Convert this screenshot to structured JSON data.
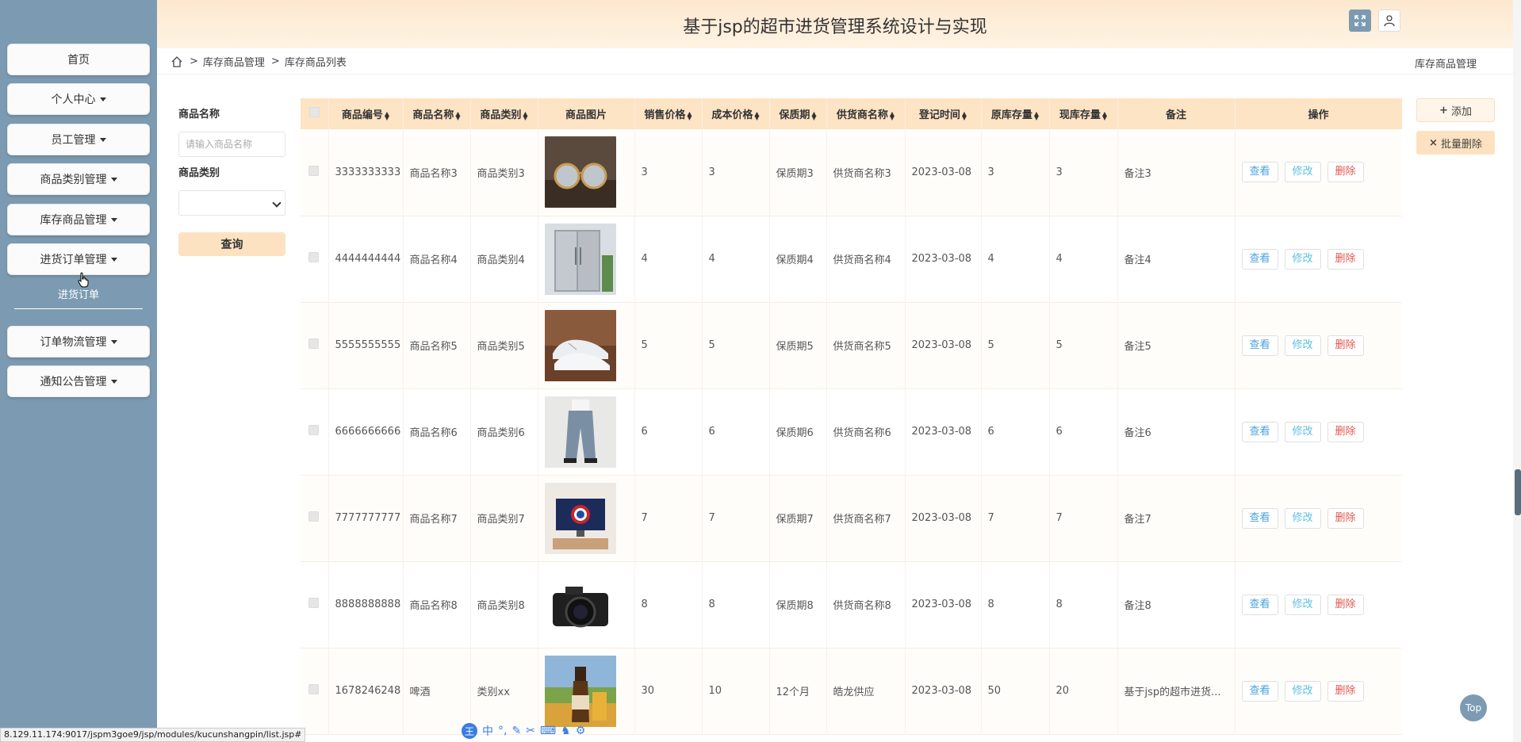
{
  "header": {
    "title": "基于jsp的超市进货管理系统设计与实现"
  },
  "sidebar": {
    "items": [
      {
        "label": "首页",
        "dropdown": false
      },
      {
        "label": "个人中心",
        "dropdown": true
      },
      {
        "label": "员工管理",
        "dropdown": true
      },
      {
        "label": "商品类别管理",
        "dropdown": true
      },
      {
        "label": "库存商品管理",
        "dropdown": true
      },
      {
        "label": "进货订单管理",
        "dropdown": true
      },
      {
        "label": "订单物流管理",
        "dropdown": true
      },
      {
        "label": "通知公告管理",
        "dropdown": true
      }
    ],
    "subitem": "进货订单"
  },
  "breadcrumb": {
    "items": [
      "库存商品管理",
      "库存商品列表"
    ],
    "right": "库存商品管理"
  },
  "search": {
    "name_label": "商品名称",
    "name_placeholder": "请输入商品名称",
    "category_label": "商品类别",
    "query_label": "查询"
  },
  "actions": {
    "add_label": "添加",
    "batch_delete_label": "批量删除"
  },
  "table": {
    "headers": [
      "商品编号",
      "商品名称",
      "商品类别",
      "商品图片",
      "销售价格",
      "成本价格",
      "保质期",
      "供货商名称",
      "登记时间",
      "原库存量",
      "现库存量",
      "备注",
      "操作"
    ],
    "rows": [
      {
        "code": "3333333333",
        "name": "商品名称3",
        "category": "商品类别3",
        "image": "glasses",
        "sale": "3",
        "cost": "3",
        "shelf": "保质期3",
        "supplier": "供货商名称3",
        "date": "2023-03-08",
        "orig": "3",
        "curr": "3",
        "note": "备注3"
      },
      {
        "code": "4444444444",
        "name": "商品名称4",
        "category": "商品类别4",
        "image": "fridge",
        "sale": "4",
        "cost": "4",
        "shelf": "保质期4",
        "supplier": "供货商名称4",
        "date": "2023-03-08",
        "orig": "4",
        "curr": "4",
        "note": "备注4"
      },
      {
        "code": "5555555555",
        "name": "商品名称5",
        "category": "商品类别5",
        "image": "sneaker",
        "sale": "5",
        "cost": "5",
        "shelf": "保质期5",
        "supplier": "供货商名称5",
        "date": "2023-03-08",
        "orig": "5",
        "curr": "5",
        "note": "备注5"
      },
      {
        "code": "6666666666",
        "name": "商品名称6",
        "category": "商品类别6",
        "image": "pants",
        "sale": "6",
        "cost": "6",
        "shelf": "保质期6",
        "supplier": "供货商名称6",
        "date": "2023-03-08",
        "orig": "6",
        "curr": "6",
        "note": "备注6"
      },
      {
        "code": "7777777777",
        "name": "商品名称7",
        "category": "商品类别7",
        "image": "monitor",
        "sale": "7",
        "cost": "7",
        "shelf": "保质期7",
        "supplier": "供货商名称7",
        "date": "2023-03-08",
        "orig": "7",
        "curr": "7",
        "note": "备注7"
      },
      {
        "code": "8888888888",
        "name": "商品名称8",
        "category": "商品类别8",
        "image": "camera",
        "sale": "8",
        "cost": "8",
        "shelf": "保质期8",
        "supplier": "供货商名称8",
        "date": "2023-03-08",
        "orig": "8",
        "curr": "8",
        "note": "备注8"
      },
      {
        "code": "1678246248",
        "name": "啤酒",
        "category": "类别xx",
        "image": "beer",
        "sale": "30",
        "cost": "10",
        "shelf": "12个月",
        "supplier": "皓龙供应",
        "date": "2023-03-08",
        "orig": "50",
        "curr": "20",
        "note": "基于jsp的超市进货..."
      }
    ],
    "ops": {
      "view": "查看",
      "edit": "修改",
      "del": "删除"
    }
  },
  "top_button": "Top",
  "status_url": "8.129.11.174:9017/jspm3goe9/jsp/modules/kucunshangpin/list.jsp#",
  "ime": {
    "logo": "王",
    "lang": "中"
  },
  "colors": {
    "sidebar": "#7c9bb2",
    "header": "#fde8cf",
    "accent": "#fde2c2"
  }
}
